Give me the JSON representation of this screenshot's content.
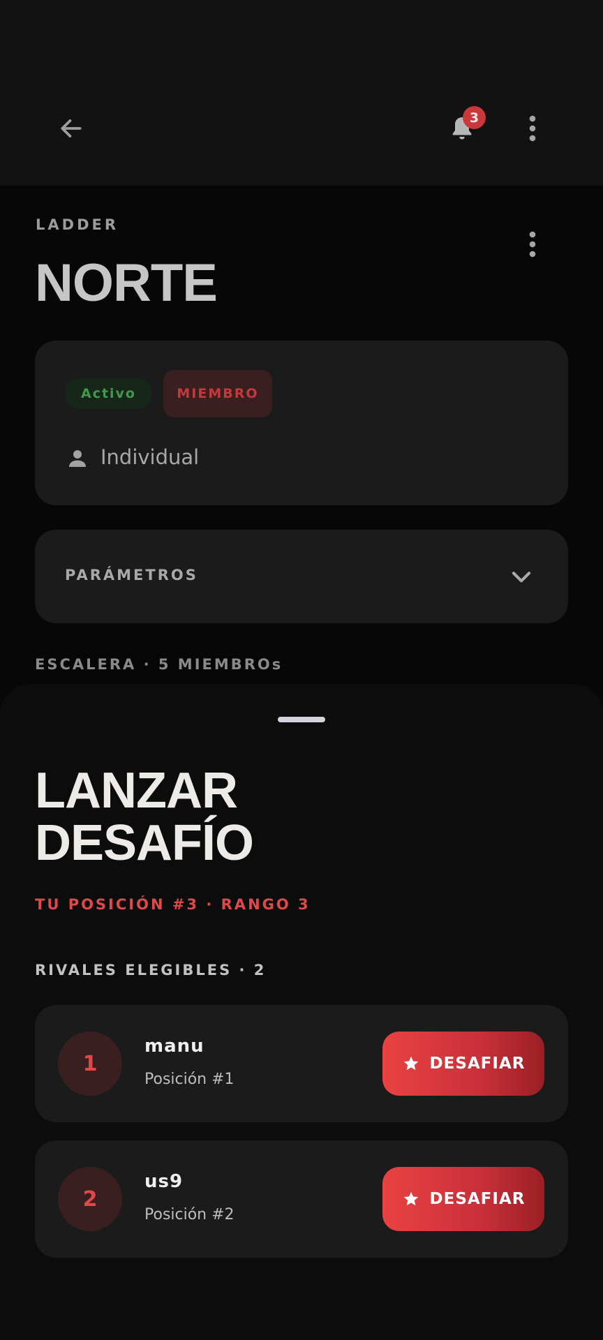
{
  "header": {
    "notification_count": "3"
  },
  "ladder": {
    "eyebrow": "LADDER",
    "name": "NORTE",
    "status_chip": "Activo",
    "role_chip": "MIEMBRO",
    "mode_label": "Individual",
    "parameters_label": "PARÁMETROS",
    "ladder_section": "ESCALERA · 5 MIEMBROs"
  },
  "sheet": {
    "title_line1": "LANZAR",
    "title_line2": "DESAFÍO",
    "position_info": "TU POSICIÓN #3 · RANGO 3",
    "rivals_header": "RIVALES ELEGIBLES · 2",
    "rivals": [
      {
        "rank": "1",
        "name": "manu",
        "position": "Posición #1",
        "button": "DESAFIAR"
      },
      {
        "rank": "2",
        "name": "us9",
        "position": "Posición #2",
        "button": "DESAFIAR"
      }
    ]
  },
  "colors": {
    "accent": "#e24848",
    "active_green": "#3f9a4a",
    "background": "#070707",
    "card": "#1b1b1b"
  },
  "icons": [
    "back-arrow-icon",
    "bell-icon",
    "more-vertical-icon",
    "person-icon",
    "chevron-down-icon",
    "star-icon"
  ]
}
